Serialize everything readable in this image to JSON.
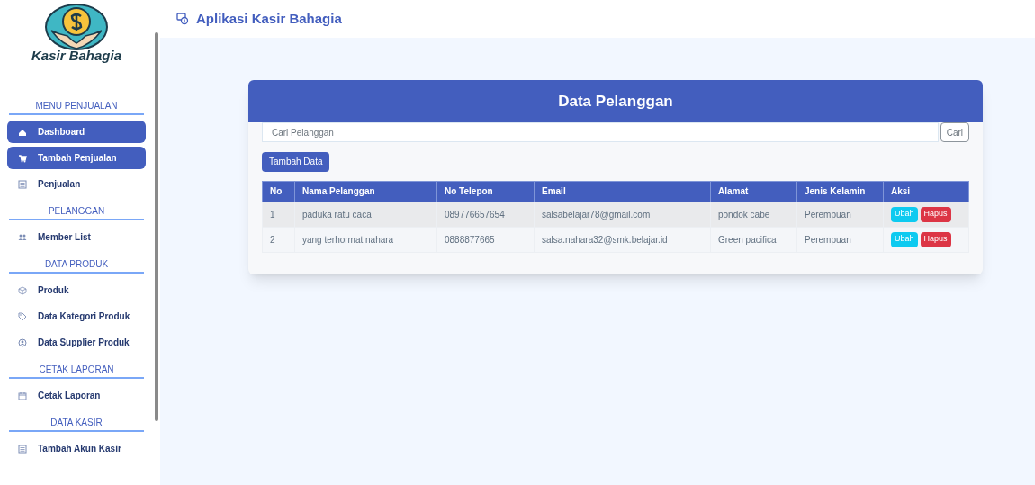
{
  "logo": {
    "text": "Kasir Bahagia"
  },
  "sidebar": [
    {
      "kind": "section",
      "label": "MENU PENJUALAN"
    },
    {
      "kind": "item",
      "label": "Dashboard",
      "active": true
    },
    {
      "kind": "item",
      "label": "Tambah Penjualan",
      "active": true
    },
    {
      "kind": "item",
      "label": "Penjualan",
      "active": false
    },
    {
      "kind": "section",
      "label": "PELANGGAN"
    },
    {
      "kind": "item",
      "label": "Member List",
      "active": false
    },
    {
      "kind": "section",
      "label": "DATA PRODUK"
    },
    {
      "kind": "item",
      "label": "Produk",
      "active": false
    },
    {
      "kind": "item",
      "label": "Data Kategori Produk",
      "active": false
    },
    {
      "kind": "item",
      "label": "Data Supplier Produk",
      "active": false
    },
    {
      "kind": "section",
      "label": "CETAK LAPORAN"
    },
    {
      "kind": "item",
      "label": "Cetak Laporan",
      "active": false
    },
    {
      "kind": "section",
      "label": "DATA KASIR"
    },
    {
      "kind": "item",
      "label": "Tambah Akun Kasir",
      "active": false
    }
  ],
  "header": {
    "title": "Aplikasi Kasir Bahagia"
  },
  "card": {
    "title": "Data Pelanggan",
    "search": {
      "placeholder": "Cari Pelanggan",
      "button": "Cari"
    },
    "add_button": "Tambah Data",
    "table": {
      "columns": [
        "No",
        "Nama Pelanggan",
        "No Telepon",
        "Email",
        "Alamat",
        "Jenis Kelamin",
        "Aksi"
      ],
      "rows": [
        {
          "cells": [
            "1",
            "paduka ratu caca",
            "089776657654",
            "salsabelajar78@gmail.com",
            "pondok cabe",
            "Perempuan"
          ],
          "actions": [
            "Ubah",
            "Hapus"
          ]
        },
        {
          "cells": [
            "2",
            "yang terhormat nahara",
            "0888877665",
            "salsa.nahara32@smk.belajar.id",
            "Green pacifica",
            "Perempuan"
          ],
          "actions": [
            "Ubah",
            "Hapus"
          ]
        }
      ]
    }
  }
}
